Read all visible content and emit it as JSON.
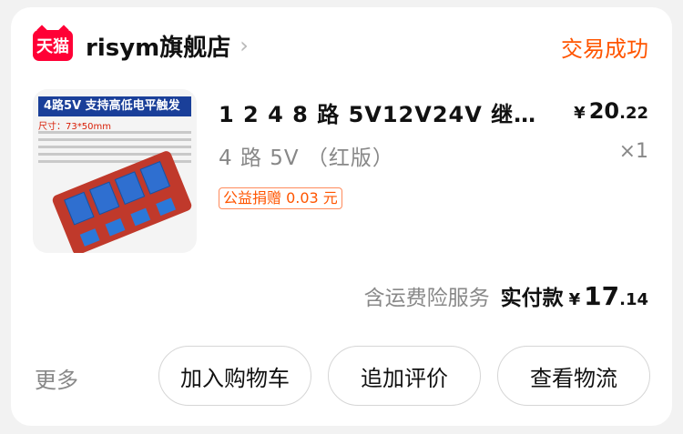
{
  "shop": {
    "logo_text": "天猫",
    "name": "risym旗舰店",
    "chevron": "›",
    "status": "交易成功"
  },
  "product": {
    "image_alt": "4路5V 支持高低电平触发 继电器模块",
    "image_banner": "4路5V 支持高低电平触发",
    "image_size": "尺寸：73*50mm",
    "title": "1 2 4 8 路 5V12V24V 继电…",
    "sku": "4 路 5V （红版）",
    "charity_tag": "公益捐赠 0.03 元",
    "price_currency": "¥",
    "price_int": "20",
    "price_dec": ".22",
    "quantity": "×1"
  },
  "totals": {
    "shipping_insurance": "含运费险服务",
    "paid_label": "实付款",
    "currency": "¥",
    "amount_int": "17",
    "amount_dec": ".14"
  },
  "actions": {
    "more": "更多",
    "add_to_cart": "加入购物车",
    "add_review": "追加评价",
    "view_logistics": "查看物流"
  },
  "colors": {
    "tmall_red": "#ff0036",
    "status_orange": "#ff5500"
  }
}
